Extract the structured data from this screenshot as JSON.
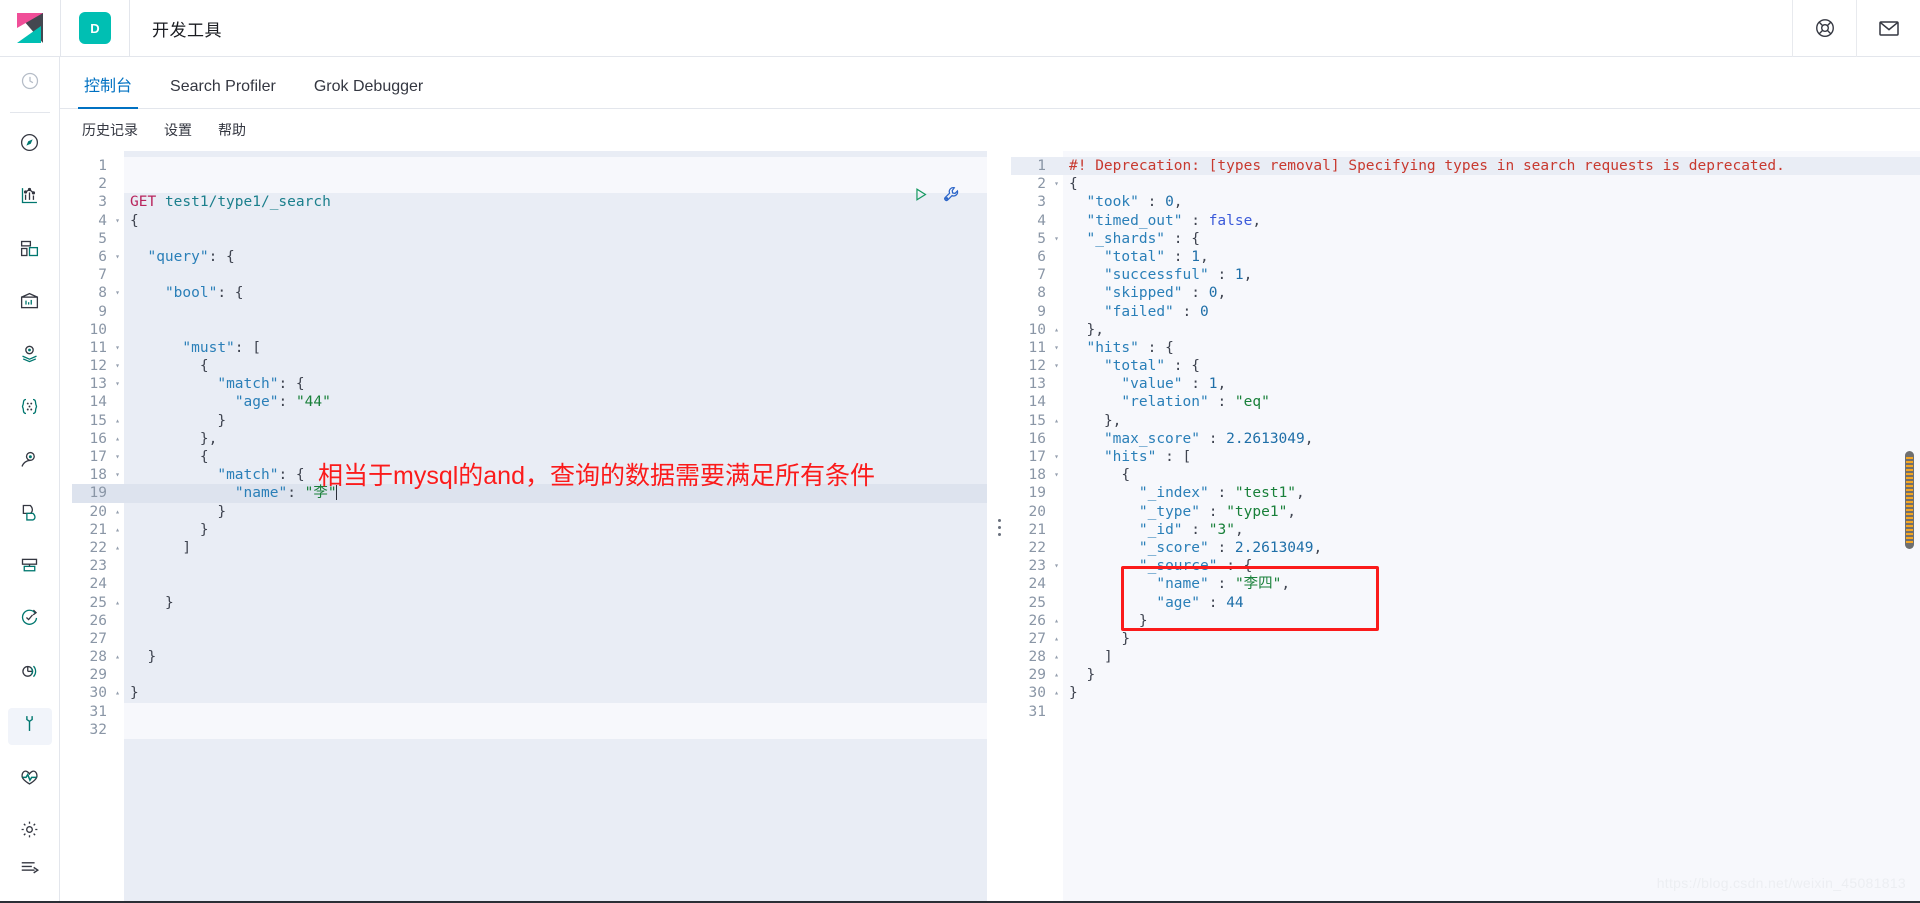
{
  "header": {
    "logo_icon": "kibana-logo",
    "space_initial": "D",
    "title": "开发工具",
    "help_icon": "life-ring-icon",
    "mail_icon": "mail-icon"
  },
  "sidebar": {
    "items": [
      {
        "name": "recently-viewed",
        "icon": "clock-icon",
        "selected": false
      },
      {
        "name": "discover",
        "icon": "compass-icon",
        "selected": false
      },
      {
        "name": "visualize",
        "icon": "chart-icon",
        "selected": false
      },
      {
        "name": "dashboard",
        "icon": "dashboard-icon",
        "selected": false
      },
      {
        "name": "canvas",
        "icon": "presentation-icon",
        "selected": false
      },
      {
        "name": "maps",
        "icon": "map-pin-layers-icon",
        "selected": false
      },
      {
        "name": "machine-learning",
        "icon": "graph-nodes-icon",
        "selected": false
      },
      {
        "name": "infrastructure",
        "icon": "user-profile-icon",
        "selected": false
      },
      {
        "name": "logs",
        "icon": "logs-icon",
        "selected": false
      },
      {
        "name": "apm",
        "icon": "apm-icon",
        "selected": false
      },
      {
        "name": "uptime",
        "icon": "uptime-check-icon",
        "selected": false
      },
      {
        "name": "siem",
        "icon": "siem-signal-icon",
        "selected": false
      },
      {
        "name": "dev-tools",
        "icon": "wrench-icon",
        "selected": true
      },
      {
        "name": "monitoring",
        "icon": "heartbeat-icon",
        "selected": false
      },
      {
        "name": "management",
        "icon": "gear-icon",
        "selected": false
      }
    ],
    "collapse": {
      "name": "collapse-nav",
      "icon": "arrow-right-bars-icon"
    }
  },
  "tabs": [
    {
      "label": "控制台",
      "active": true
    },
    {
      "label": "Search Profiler",
      "active": false
    },
    {
      "label": "Grok Debugger",
      "active": false
    }
  ],
  "submenu": [
    {
      "label": "历史记录"
    },
    {
      "label": "设置"
    },
    {
      "label": "帮助"
    }
  ],
  "editor_actions": {
    "run_label": "send-request",
    "run_icon": "play-triangle-icon",
    "wrench_label": "open-documentation",
    "wrench_icon": "wrench-icon"
  },
  "request_editor": {
    "name": "console-request-editor",
    "cursor_line": 19,
    "total_lines": 32,
    "method": "GET",
    "path": "test1/type1/_search",
    "lines": [
      {
        "n": 1,
        "fold": "",
        "text": ""
      },
      {
        "n": 2,
        "fold": "",
        "text": ""
      },
      {
        "n": 3,
        "fold": "",
        "text": "GET test1/type1/_search"
      },
      {
        "n": 4,
        "fold": "▾",
        "text": "{"
      },
      {
        "n": 5,
        "fold": "",
        "text": ""
      },
      {
        "n": 6,
        "fold": "▾",
        "text": "  \"query\": {"
      },
      {
        "n": 7,
        "fold": "",
        "text": ""
      },
      {
        "n": 8,
        "fold": "▾",
        "text": "    \"bool\": {"
      },
      {
        "n": 9,
        "fold": "",
        "text": ""
      },
      {
        "n": 10,
        "fold": "",
        "text": ""
      },
      {
        "n": 11,
        "fold": "▾",
        "text": "      \"must\": ["
      },
      {
        "n": 12,
        "fold": "▾",
        "text": "        {"
      },
      {
        "n": 13,
        "fold": "▾",
        "text": "          \"match\": {"
      },
      {
        "n": 14,
        "fold": "",
        "text": "            \"age\": \"44\""
      },
      {
        "n": 15,
        "fold": "▴",
        "text": "          }"
      },
      {
        "n": 16,
        "fold": "▴",
        "text": "        },"
      },
      {
        "n": 17,
        "fold": "▾",
        "text": "        {"
      },
      {
        "n": 18,
        "fold": "▾",
        "text": "          \"match\": {"
      },
      {
        "n": 19,
        "fold": "",
        "text": "            \"name\": \"李\""
      },
      {
        "n": 20,
        "fold": "▴",
        "text": "          }"
      },
      {
        "n": 21,
        "fold": "▴",
        "text": "        }"
      },
      {
        "n": 22,
        "fold": "▴",
        "text": "      ]"
      },
      {
        "n": 23,
        "fold": "",
        "text": ""
      },
      {
        "n": 24,
        "fold": "",
        "text": ""
      },
      {
        "n": 25,
        "fold": "▴",
        "text": "    }"
      },
      {
        "n": 26,
        "fold": "",
        "text": ""
      },
      {
        "n": 27,
        "fold": "",
        "text": ""
      },
      {
        "n": 28,
        "fold": "▴",
        "text": "  }"
      },
      {
        "n": 29,
        "fold": "",
        "text": ""
      },
      {
        "n": 30,
        "fold": "▴",
        "text": "}"
      },
      {
        "n": 31,
        "fold": "",
        "text": ""
      },
      {
        "n": 32,
        "fold": "",
        "text": ""
      }
    ]
  },
  "response_editor": {
    "name": "console-response-editor",
    "total_lines": 31,
    "warning_line": "#! Deprecation: [types removal] Specifying types in search requests is deprecated.",
    "lines": [
      {
        "n": 1,
        "fold": "",
        "text": "#! Deprecation: [types removal] Specifying types in search requests is deprecated."
      },
      {
        "n": 2,
        "fold": "▾",
        "text": "{"
      },
      {
        "n": 3,
        "fold": "",
        "text": "  \"took\" : 0,"
      },
      {
        "n": 4,
        "fold": "",
        "text": "  \"timed_out\" : false,"
      },
      {
        "n": 5,
        "fold": "▾",
        "text": "  \"_shards\" : {"
      },
      {
        "n": 6,
        "fold": "",
        "text": "    \"total\" : 1,"
      },
      {
        "n": 7,
        "fold": "",
        "text": "    \"successful\" : 1,"
      },
      {
        "n": 8,
        "fold": "",
        "text": "    \"skipped\" : 0,"
      },
      {
        "n": 9,
        "fold": "",
        "text": "    \"failed\" : 0"
      },
      {
        "n": 10,
        "fold": "▴",
        "text": "  },"
      },
      {
        "n": 11,
        "fold": "▾",
        "text": "  \"hits\" : {"
      },
      {
        "n": 12,
        "fold": "▾",
        "text": "    \"total\" : {"
      },
      {
        "n": 13,
        "fold": "",
        "text": "      \"value\" : 1,"
      },
      {
        "n": 14,
        "fold": "",
        "text": "      \"relation\" : \"eq\""
      },
      {
        "n": 15,
        "fold": "▴",
        "text": "    },"
      },
      {
        "n": 16,
        "fold": "",
        "text": "    \"max_score\" : 2.2613049,"
      },
      {
        "n": 17,
        "fold": "▾",
        "text": "    \"hits\" : ["
      },
      {
        "n": 18,
        "fold": "▾",
        "text": "      {"
      },
      {
        "n": 19,
        "fold": "",
        "text": "        \"_index\" : \"test1\","
      },
      {
        "n": 20,
        "fold": "",
        "text": "        \"_type\" : \"type1\","
      },
      {
        "n": 21,
        "fold": "",
        "text": "        \"_id\" : \"3\","
      },
      {
        "n": 22,
        "fold": "",
        "text": "        \"_score\" : 2.2613049,"
      },
      {
        "n": 23,
        "fold": "▾",
        "text": "        \"_source\" : {"
      },
      {
        "n": 24,
        "fold": "",
        "text": "          \"name\" : \"李四\","
      },
      {
        "n": 25,
        "fold": "",
        "text": "          \"age\" : 44"
      },
      {
        "n": 26,
        "fold": "▴",
        "text": "        }"
      },
      {
        "n": 27,
        "fold": "▴",
        "text": "      }"
      },
      {
        "n": 28,
        "fold": "▴",
        "text": "    ]"
      },
      {
        "n": 29,
        "fold": "▴",
        "text": "  }"
      },
      {
        "n": 30,
        "fold": "▴",
        "text": "}"
      },
      {
        "n": 31,
        "fold": "",
        "text": ""
      }
    ]
  },
  "annotations": {
    "note_text": "相当于mysql的and，查询的数据需要满足所有条件",
    "note_color": "#fb1b1b",
    "highlight_box_color": "#fb1b1b"
  },
  "watermark": {
    "text": "https://blog.csdn.net/weixin_45081813"
  },
  "colors": {
    "accent": "#0071c2",
    "teal": "#00bfb3",
    "pink": "#f04e98",
    "editor_active_bg": "#e9edf5",
    "editor_response_bg": "#f7f8fc",
    "current_line": "#dde3ee"
  }
}
